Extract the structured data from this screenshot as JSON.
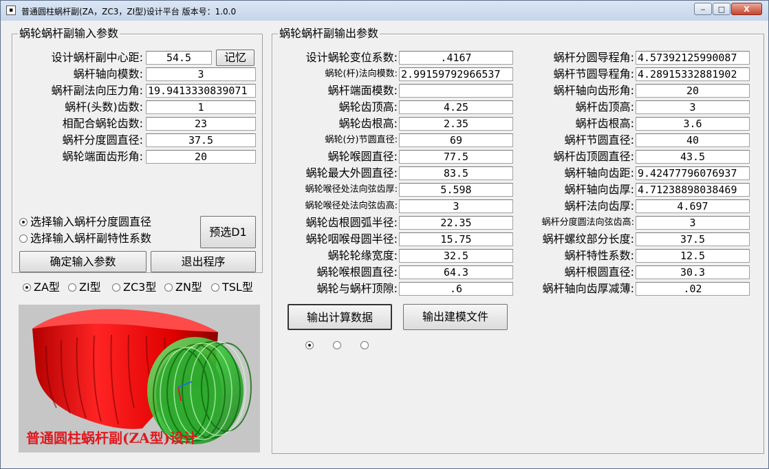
{
  "window": {
    "icon": "window-app-icon",
    "title": "普通圆柱蜗杆副(ZA，ZC3，ZI型)设计平台  版本号：1.0.0",
    "min": "‒",
    "max": "□",
    "close": "X"
  },
  "input_panel": {
    "title": "蜗轮蜗杆副输入参数",
    "rows": [
      {
        "label": "设计蜗杆副中心距:",
        "value": "54.5"
      },
      {
        "label": "蜗杆轴向模数:",
        "value": "3"
      },
      {
        "label": "蜗杆副法向压力角:",
        "value": "19.9413330839071"
      },
      {
        "label": "蜗杆(头数)齿数:",
        "value": "1"
      },
      {
        "label": "相配合蜗轮齿数:",
        "value": "23"
      },
      {
        "label": "蜗杆分度圆直径:",
        "value": "37.5"
      },
      {
        "label": "蜗轮端面齿形角:",
        "value": "20"
      }
    ],
    "memory_button": "记忆",
    "radio_diameter": "选择输入蜗杆分度圆直径",
    "radio_coefficient": "选择输入蜗杆副特性系数",
    "preselect_button": "预选D1",
    "confirm_button": "确定输入参数",
    "exit_button": "退出程序"
  },
  "type_selector": [
    {
      "label": "ZA型",
      "selected": true
    },
    {
      "label": "ZI型",
      "selected": false
    },
    {
      "label": "ZC3型",
      "selected": false
    },
    {
      "label": "ZN型",
      "selected": false
    },
    {
      "label": "TSL型",
      "selected": false
    }
  ],
  "model_preview": {
    "caption": "普通圆柱蜗杆副(ZA型)设计",
    "wheel_color": "#ff1a1a",
    "worm_color": "#33cc33",
    "caption_color": "#e0191f"
  },
  "output_panel": {
    "title": "蜗轮蜗杆副输出参数",
    "left_rows": [
      {
        "label": "设计蜗轮变位系数:",
        "value": ".4167"
      },
      {
        "label": "蜗轮(杆)法向模数:",
        "value": "2.99159792966537"
      },
      {
        "label": "蜗杆端面模数:",
        "value": ""
      },
      {
        "label": "蜗轮齿顶高:",
        "value": "4.25"
      },
      {
        "label": "蜗轮齿根高:",
        "value": "2.35"
      },
      {
        "label": "蜗轮(分)节圆直径:",
        "value": "69"
      },
      {
        "label": "蜗轮喉圆直径:",
        "value": "77.5"
      },
      {
        "label": "蜗轮最大外圆直径:",
        "value": "83.5"
      },
      {
        "label": "蜗轮喉径处法向弦齿厚:",
        "value": "5.598"
      },
      {
        "label": "蜗轮喉径处法向弦齿高:",
        "value": "3"
      },
      {
        "label": "蜗轮齿根圆弧半径:",
        "value": "22.35"
      },
      {
        "label": "蜗轮咽喉母圆半径:",
        "value": "15.75"
      },
      {
        "label": "蜗轮轮缘宽度:",
        "value": "32.5"
      },
      {
        "label": "蜗轮喉根圆直径:",
        "value": "64.3"
      },
      {
        "label": "蜗轮与蜗杆顶隙:",
        "value": ".6"
      }
    ],
    "right_rows": [
      {
        "label": "蜗杆分圆导程角:",
        "value": "4.57392125990087"
      },
      {
        "label": "蜗杆节圆导程角:",
        "value": "4.28915332881902"
      },
      {
        "label": "蜗杆轴向齿形角:",
        "value": "20"
      },
      {
        "label": "蜗杆齿顶高:",
        "value": "3"
      },
      {
        "label": "蜗杆齿根高:",
        "value": "3.6"
      },
      {
        "label": "蜗杆节圆直径:",
        "value": "40"
      },
      {
        "label": "蜗杆齿顶圆直径:",
        "value": "43.5"
      },
      {
        "label": "蜗杆轴向齿距:",
        "value": "9.42477796076937"
      },
      {
        "label": "蜗杆轴向齿厚:",
        "value": "4.71238898038469"
      },
      {
        "label": "蜗杆法向齿厚:",
        "value": "4.697"
      },
      {
        "label": "蜗杆分度圆法向弦齿高:",
        "value": "3"
      },
      {
        "label": "蜗杆螺纹部分长度:",
        "value": "37.5"
      },
      {
        "label": "蜗杆特性系数:",
        "value": "12.5"
      },
      {
        "label": "蜗杆根圆直径:",
        "value": "30.3"
      },
      {
        "label": "蜗杆轴向齿厚减薄:",
        "value": ".02"
      }
    ],
    "export_data_button": "输出计算数据",
    "export_model_button": "输出建模文件",
    "option_radios": [
      true,
      false,
      false
    ]
  }
}
